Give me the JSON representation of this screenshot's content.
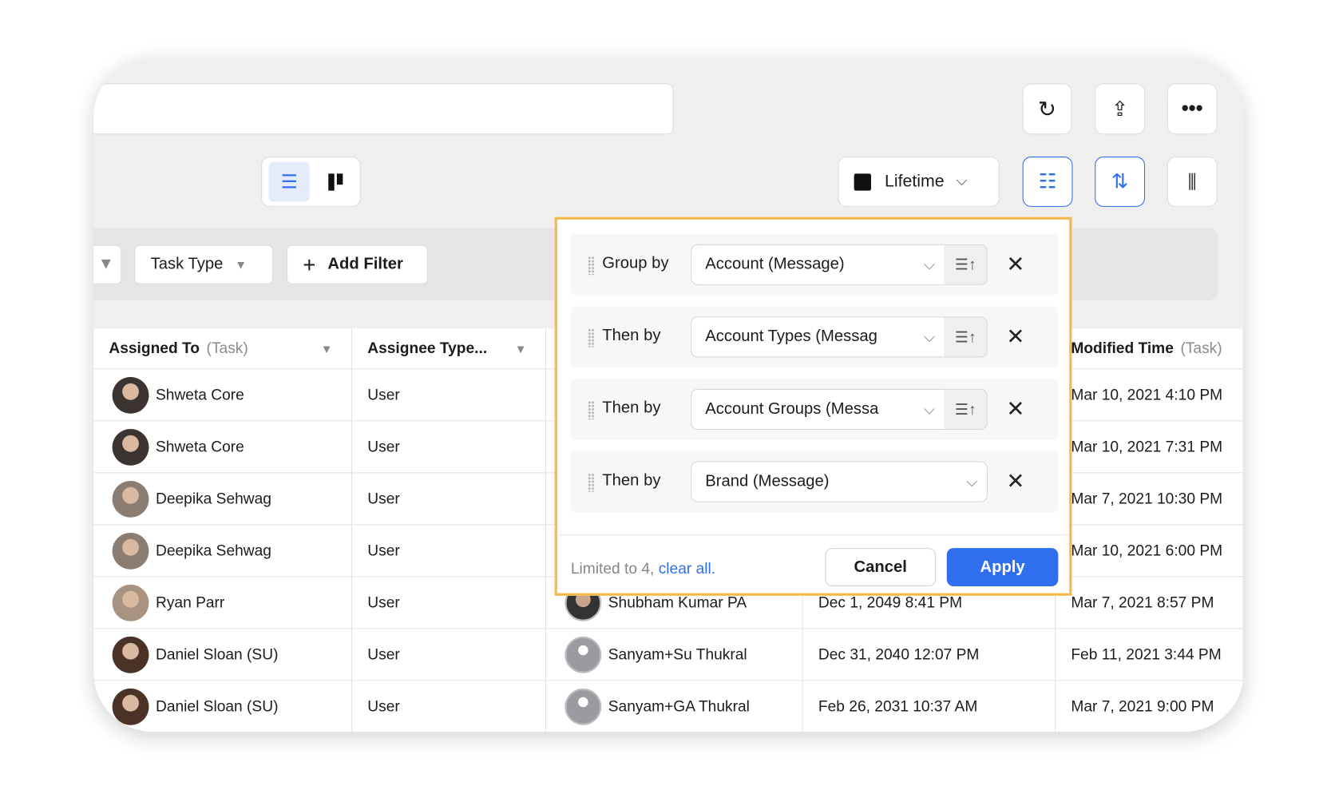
{
  "toolbar": {
    "refresh_icon": "refresh-icon",
    "export_icon": "upload-icon",
    "more_icon": "more-icon",
    "date_range": "Lifetime"
  },
  "colors": {
    "accent": "#2f6fed",
    "highlight": "#f5b94a"
  },
  "filters": [
    {
      "label": "Task Type"
    },
    {
      "label": "Add Filter"
    }
  ],
  "table": {
    "headers": [
      {
        "label": "Assigned To",
        "sub": "(Task)"
      },
      {
        "label": "Assignee Type..."
      },
      {
        "label": ""
      },
      {
        "label": ""
      },
      {
        "label": "Modified Time",
        "sub": "(Task)"
      }
    ],
    "rows": [
      {
        "assigned": "Shweta Core",
        "type": "User",
        "c3": "",
        "c4": "",
        "modified": "Mar 10, 2021 4:10 PM"
      },
      {
        "assigned": "Shweta Core",
        "type": "User",
        "c3": "",
        "c4": "",
        "modified": "Mar 10, 2021 7:31 PM"
      },
      {
        "assigned": "Deepika Sehwag",
        "type": "User",
        "c3": "",
        "c4": "",
        "modified": "Mar 7, 2021 10:30 PM"
      },
      {
        "assigned": "Deepika Sehwag",
        "type": "User",
        "c3": "",
        "c4": "",
        "modified": "Mar 10, 2021 6:00 PM"
      },
      {
        "assigned": "Ryan Parr",
        "type": "User",
        "c3": "Shubham Kumar PA",
        "c4": "Dec 1, 2049 8:41 PM",
        "modified": "Mar 7, 2021 8:57 PM"
      },
      {
        "assigned": "Daniel Sloan (SU)",
        "type": "User",
        "c3": "Sanyam+Su Thukral",
        "c4": "Dec 31, 2040 12:07 PM",
        "modified": "Feb 11, 2021 3:44 PM"
      },
      {
        "assigned": "Daniel Sloan (SU)",
        "type": "User",
        "c3": "Sanyam+GA Thukral",
        "c4": "Feb 26, 2031 10:37 AM",
        "modified": "Mar 7, 2021 9:00 PM"
      }
    ]
  },
  "group_popup": {
    "rows": [
      {
        "label": "Group by",
        "value": "Account (Message)"
      },
      {
        "label": "Then by",
        "value": "Account Types (Messag"
      },
      {
        "label": "Then by",
        "value": "Account Groups (Messa"
      },
      {
        "label": "Then by",
        "value": "Brand (Message)"
      }
    ],
    "limit_text": "Limited to 4,",
    "clear_all": "clear all.",
    "cancel": "Cancel",
    "apply": "Apply"
  }
}
